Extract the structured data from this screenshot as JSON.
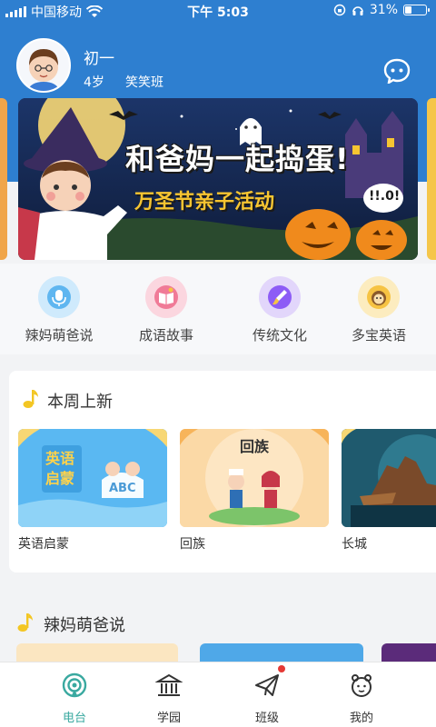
{
  "status_bar": {
    "carrier": "中国移动",
    "time": "下午 5:03",
    "battery_percent": "31%",
    "battery_level": 0.31,
    "icons": [
      "signal-icon",
      "wifi-icon",
      "rotation-lock-icon",
      "headphones-icon",
      "battery-icon"
    ]
  },
  "profile": {
    "name": "初一",
    "age": "4岁",
    "class_name": "笑笑班",
    "avatar_icon": "child-avatar-icon",
    "chat_icon": "chat-bubble-icon"
  },
  "banner": {
    "title": "和爸妈一起捣蛋!",
    "subtitle": "万圣节亲子活动",
    "speech_bubble": "!!.0!"
  },
  "categories": [
    {
      "label": "辣妈萌爸说",
      "icon": "microphone-icon",
      "color": "#5fb6f0"
    },
    {
      "label": "成语故事",
      "icon": "book-icon",
      "color": "#f07a97"
    },
    {
      "label": "传统文化",
      "icon": "brush-icon",
      "color": "#8d5cf6"
    },
    {
      "label": "多宝英语",
      "icon": "lion-icon",
      "color": "#f6c343"
    }
  ],
  "new_this_week": {
    "title": "本周上新",
    "items": [
      {
        "label": "英语启蒙",
        "thumb_text": "英语启蒙",
        "thumb_extra": "ABC"
      },
      {
        "label": "回族",
        "thumb_text": "回族"
      },
      {
        "label": "长城"
      }
    ]
  },
  "section2": {
    "title": "辣妈萌爸说"
  },
  "tabbar": {
    "tabs": [
      {
        "label": "电台",
        "icon": "radio-icon",
        "active": true
      },
      {
        "label": "学园",
        "icon": "school-icon",
        "active": false
      },
      {
        "label": "班级",
        "icon": "paper-plane-icon",
        "active": false
      },
      {
        "label": "我的",
        "icon": "face-icon",
        "active": false
      }
    ]
  },
  "colors": {
    "header_blue": "#2e7fd0",
    "accent_teal": "#3aa9a0",
    "note_yellow": "#f3c623",
    "badge_red": "#e53935"
  }
}
